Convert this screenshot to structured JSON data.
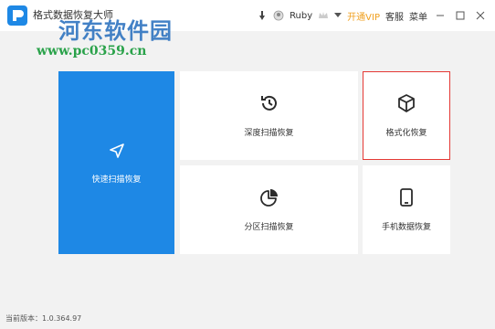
{
  "app": {
    "title": "格式数据恢复大师",
    "watermark_site": "河东软件园",
    "watermark_url": "www.pc0359.cn"
  },
  "titlebar": {
    "user_name": "Ruby",
    "vip_label": "开通VIP",
    "support_label": "客服",
    "menu_label": "菜单"
  },
  "cards": {
    "quick_scan": "快速扫描恢复",
    "deep_scan": "深度扫描恢复",
    "format_recovery": "格式化恢复",
    "partition_scan": "分区扫描恢复",
    "phone_recovery": "手机数据恢复"
  },
  "footer": {
    "version_label": "当前版本：1.0.364.97"
  },
  "colors": {
    "primary": "#1e88e5",
    "selected_border": "#e53935",
    "vip": "#f0a020"
  }
}
